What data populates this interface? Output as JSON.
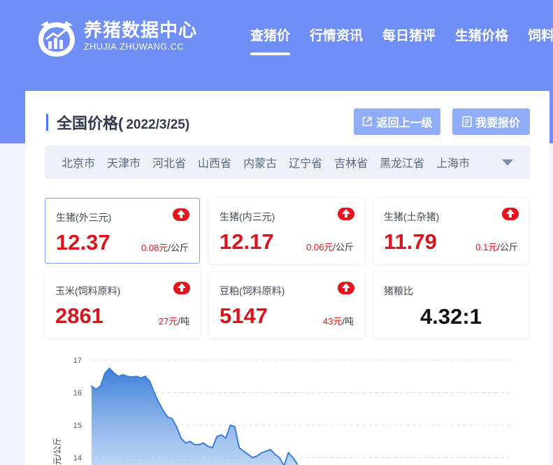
{
  "site": {
    "title": "养猪数据中心",
    "subtitle": "ZHUJIA.ZHUWANG.CC"
  },
  "nav": [
    "查猪价",
    "行情资讯",
    "每日猪评",
    "生猪价格",
    "饲料"
  ],
  "page": {
    "title": "全国价格(",
    "date": "2022/3/25)",
    "back_label": "返回上一级",
    "quote_label": "我要报价"
  },
  "regions": [
    "北京市",
    "天津市",
    "河北省",
    "山西省",
    "内蒙古",
    "辽宁省",
    "吉林省",
    "黑龙江省",
    "上海市"
  ],
  "tiles": [
    {
      "name": "生猪(外三元)",
      "price": "12.37",
      "change": "0.08元",
      "unit": "/公斤"
    },
    {
      "name": "生猪(内三元)",
      "price": "12.17",
      "change": "0.06元",
      "unit": "/公斤"
    },
    {
      "name": "生猪(土杂猪)",
      "price": "11.79",
      "change": "0.1元",
      "unit": "/公斤"
    },
    {
      "name": "玉米(饲料原料)",
      "price": "2861",
      "change": "27元",
      "unit": "/吨"
    },
    {
      "name": "豆粕(饲料原料)",
      "price": "5147",
      "change": "43元",
      "unit": "/吨"
    },
    {
      "name": "猪粮比",
      "price": "4.32:1"
    }
  ],
  "colors": {
    "header": "#6f8ff6",
    "accent": "#4a73f0",
    "price_red": "#d9141b",
    "up_icon": "#e3141c",
    "chart_line": "#3d7fd8"
  },
  "icons": {
    "back": "external-link-icon",
    "quote": "document-icon",
    "up": "up-arrow-icon",
    "toggle": "caret-down-icon"
  },
  "chart_data": {
    "type": "area",
    "ylabel": "元/公斤",
    "yticks": [
      14,
      15,
      16,
      17
    ],
    "ylim": [
      13.6,
      17
    ],
    "grid": true,
    "series": [
      {
        "values": [
          16.2,
          16.1,
          16.2,
          16.6,
          16.75,
          16.6,
          16.5,
          16.55,
          16.5,
          16.48,
          16.5,
          16.45,
          16.5,
          16.35,
          16.0,
          15.7,
          15.45,
          15.25,
          15.2,
          14.95,
          14.6,
          14.45,
          14.5,
          14.4,
          14.4,
          14.45,
          14.35,
          14.3,
          14.65,
          14.7,
          14.6,
          15.0,
          14.95,
          14.3,
          14.2,
          14.1,
          14.0,
          14.05,
          14.15,
          14.2,
          14.25,
          14.1,
          14.0,
          13.75,
          14.15,
          14.0,
          13.8
        ]
      }
    ]
  }
}
